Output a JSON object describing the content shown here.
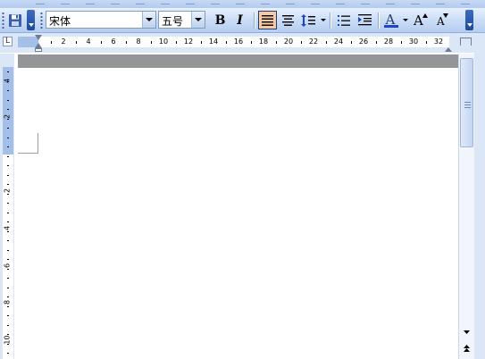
{
  "toolbar": {
    "font_name": "宋体",
    "font_size": "五号",
    "bold_label": "B",
    "italic_label": "I",
    "font_color_label": "A",
    "grow_font_label": "A",
    "shrink_font_label": "A",
    "font_color_hex": "#1d44c8"
  },
  "ruler": {
    "corner_label": "L",
    "horizontal_numbers": [
      "2",
      "4",
      "6",
      "8",
      "10",
      "12",
      "14",
      "16",
      "18",
      "20",
      "22",
      "24",
      "26",
      "28",
      "30",
      "32"
    ],
    "vertical_top_numbers": [
      "4",
      "2"
    ],
    "vertical_bottom_numbers": [
      "2",
      "4",
      "6",
      "8",
      "10"
    ]
  },
  "colors": {
    "toolbar_bg": "#cddff8",
    "ruler_margin": "#a5c0e8",
    "active_button": "#f8c9a2",
    "page_band": "#939598"
  }
}
